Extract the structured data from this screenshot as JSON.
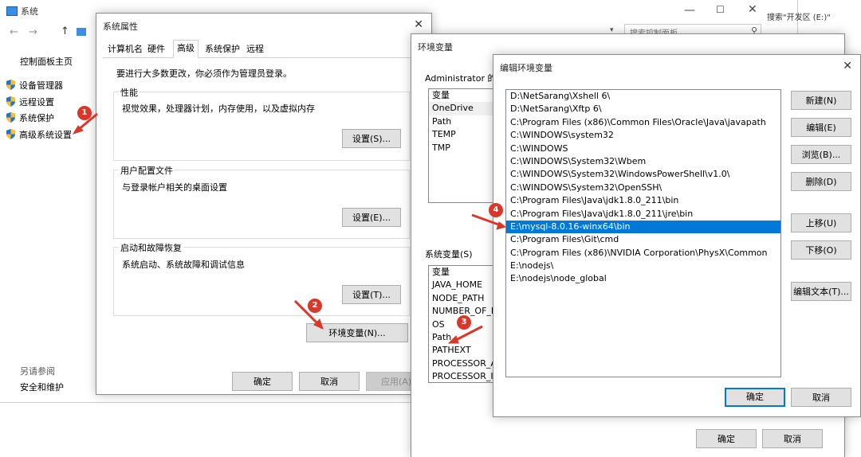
{
  "system_window": {
    "title": "系统",
    "nav_back": "←",
    "nav_forward": "→",
    "nav_up": "↑",
    "sidebar_home": "控制面板主页",
    "links": [
      "设备管理器",
      "远程设置",
      "系统保护",
      "高级系统设置"
    ],
    "see_also": "另请参阅",
    "security": "安全和维护",
    "search_placeholder": "搜索控制面板",
    "search_tab": "搜索\"开发区 (E:)\""
  },
  "props_dialog": {
    "title": "系统属性",
    "tabs": [
      "计算机名",
      "硬件",
      "高级",
      "系统保护",
      "远程"
    ],
    "admin_note": "要进行大多数更改，你必须作为管理员登录。",
    "perf": {
      "title": "性能",
      "desc": "视觉效果，处理器计划，内存使用，以及虚拟内存",
      "button": "设置(S)..."
    },
    "profile": {
      "title": "用户配置文件",
      "desc": "与登录帐户相关的桌面设置",
      "button": "设置(E)..."
    },
    "startup": {
      "title": "启动和故障恢复",
      "desc": "系统启动、系统故障和调试信息",
      "button": "设置(T)..."
    },
    "env_button": "环境变量(N)...",
    "ok": "确定",
    "cancel": "取消",
    "apply": "应用(A)"
  },
  "env_dialog": {
    "title": "环境变量",
    "user_label": "Administrator 的用",
    "user_vars_header": "变量",
    "user_vars": [
      "OneDrive",
      "Path",
      "TEMP",
      "TMP"
    ],
    "sys_label": "系统变量(S)",
    "sys_vars_header": "变量",
    "sys_vars": [
      "JAVA_HOME",
      "NODE_PATH",
      "NUMBER_OF_P",
      "OS",
      "Path",
      "PATHEXT",
      "PROCESSOR_AI",
      "PROCESSOR_ID"
    ],
    "ok": "确定",
    "cancel": "取消"
  },
  "edit_dialog": {
    "title": "编辑环境变量",
    "paths": [
      "D:\\NetSarang\\Xshell 6\\",
      "D:\\NetSarang\\Xftp 6\\",
      "C:\\Program Files (x86)\\Common Files\\Oracle\\Java\\javapath",
      "C:\\WINDOWS\\system32",
      "C:\\WINDOWS",
      "C:\\WINDOWS\\System32\\Wbem",
      "C:\\WINDOWS\\System32\\WindowsPowerShell\\v1.0\\",
      "C:\\WINDOWS\\System32\\OpenSSH\\",
      "C:\\Program Files\\Java\\jdk1.8.0_211\\bin",
      "C:\\Program Files\\Java\\jdk1.8.0_211\\jre\\bin",
      "E:\\mysql-8.0.16-winx64\\bin",
      "C:\\Program Files\\Git\\cmd",
      "C:\\Program Files (x86)\\NVIDIA Corporation\\PhysX\\Common",
      "E:\\nodejs\\",
      "E:\\nodejs\\node_global"
    ],
    "selected_index": 10,
    "buttons": {
      "new": "新建(N)",
      "edit": "编辑(E)",
      "browse": "浏览(B)...",
      "delete": "删除(D)",
      "up": "上移(U)",
      "down": "下移(O)",
      "edit_text": "编辑文本(T)..."
    },
    "ok": "确定",
    "cancel": "取消"
  },
  "markers": [
    "1",
    "2",
    "3",
    "4"
  ],
  "colors": {
    "accent": "#0078d7",
    "marker": "#d8372a",
    "shield_blue": "#2a6fc9",
    "shield_yellow": "#f2c230"
  }
}
